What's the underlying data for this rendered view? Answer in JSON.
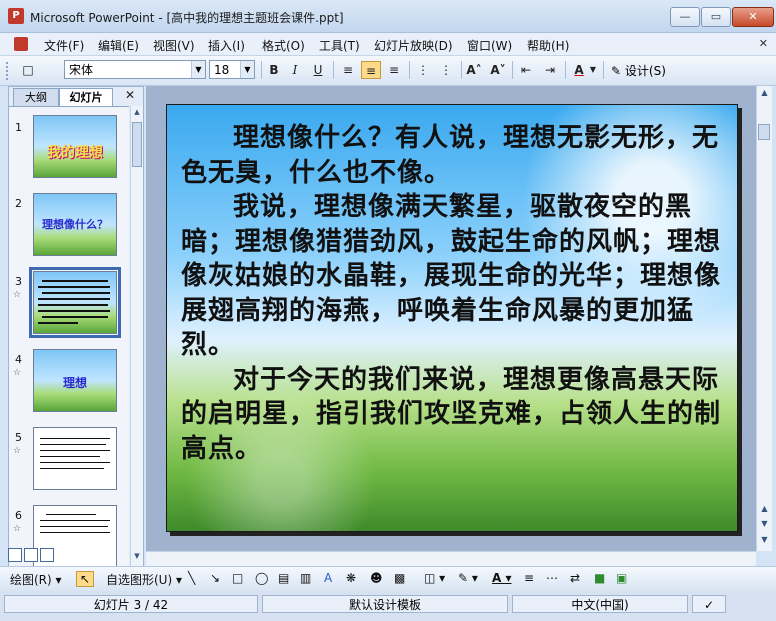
{
  "window": {
    "title": "Microsoft PowerPoint - [高中我的理想主题班会课件.ppt]",
    "min": "▭",
    "max": "▭",
    "close": "✕"
  },
  "menu": [
    "文件(F)",
    "编辑(E)",
    "视图(V)",
    "插入(I)",
    "格式(O)",
    "工具(T)",
    "幻灯片放映(D)",
    "窗口(W)",
    "帮助(H)"
  ],
  "toolbar": {
    "font_name": "宋体",
    "font_size": "18",
    "bold": "B",
    "italic": "I",
    "underline": "U",
    "design_label": "设计(S)"
  },
  "side_pane": {
    "tab_outline": "大纲",
    "tab_slides": "幻灯片",
    "close": "✕",
    "slides": [
      {
        "num": "1",
        "title": "我的理想"
      },
      {
        "num": "2",
        "title": "理想像什么？"
      },
      {
        "num": "3",
        "title": ""
      },
      {
        "num": "4",
        "title": "理想"
      },
      {
        "num": "5",
        "title": ""
      },
      {
        "num": "6",
        "title": ""
      }
    ],
    "star": "☆"
  },
  "slide": {
    "paragraphs": [
      "理想像什么？有人说，理想无影无形，无色无臭，什么也不像。",
      "我说，理想像满天繁星，驱散夜空的黑暗；理想像猎猎劲风，鼓起生命的风帆；理想像灰姑娘的水晶鞋，展现生命的光华；理想像展翅高翔的海燕，呼唤着生命风暴的更加猛烈。",
      "对于今天的我们来说，理想更像高悬天际的启明星，指引我们攻坚克难，占领人生的制高点。"
    ]
  },
  "drawing_toolbar": {
    "draw_label": "绘图(R)",
    "autoshapes_label": "自选图形(U)"
  },
  "status": {
    "slide_position": "幻灯片 3 / 42",
    "template": "默认设计模板",
    "language": "中文(中国)"
  }
}
